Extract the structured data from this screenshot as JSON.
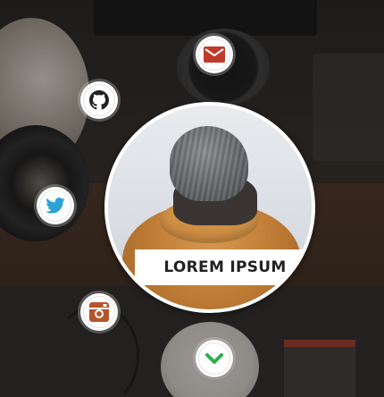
{
  "profile": {
    "caption": "LOREM IPSUM"
  },
  "social_buttons": [
    {
      "name": "mail",
      "icon": "envelope-icon",
      "color": "#c0392b"
    },
    {
      "name": "github",
      "icon": "github-icon",
      "color": "#222222"
    },
    {
      "name": "twitter",
      "icon": "twitter-bird-icon",
      "color": "#2aa3d6"
    },
    {
      "name": "instagram",
      "icon": "instagram-icon",
      "color": "#b5542b"
    },
    {
      "name": "more",
      "icon": "chevron-down-icon",
      "color": "#2eae4f"
    }
  ]
}
